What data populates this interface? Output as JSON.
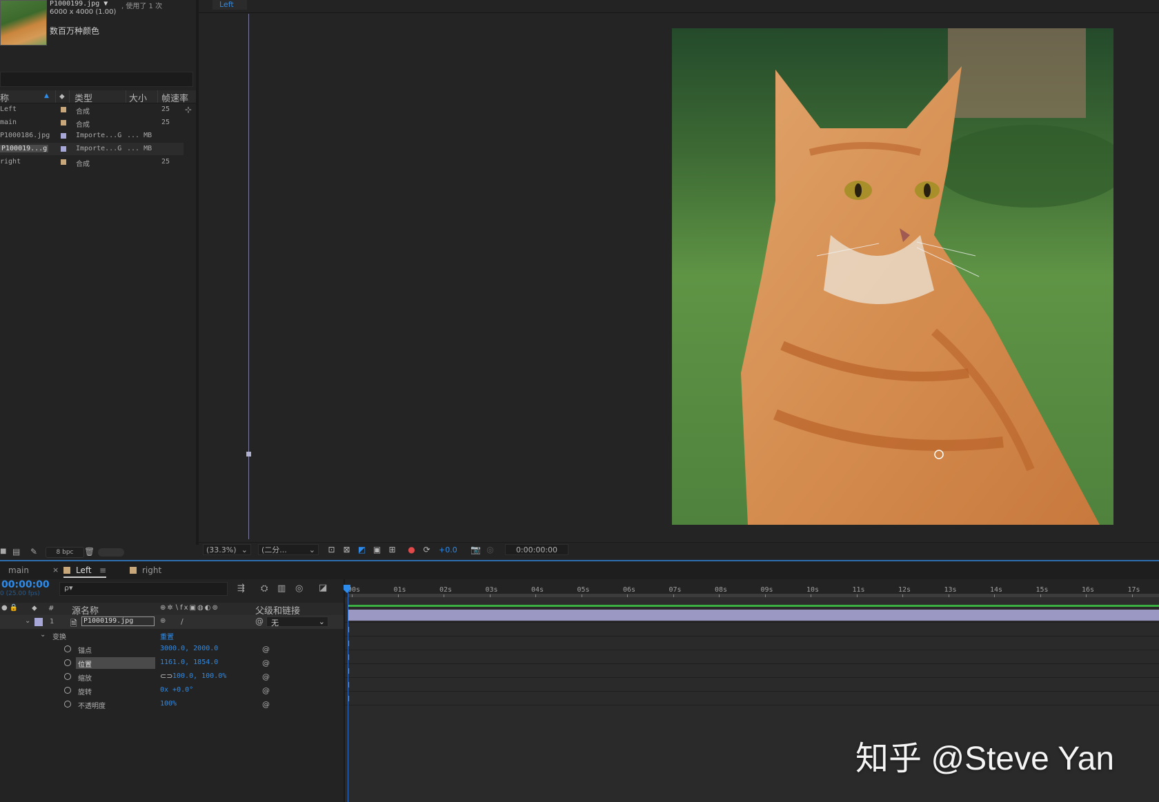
{
  "project": {
    "thumb_name": "P1000199.jpg ▼",
    "thumb_used": ", 使用了 1 次",
    "thumb_dims": "6000 x 4000 (1.00)",
    "thumb_color": "数百万种颜色",
    "columns": {
      "name": "称",
      "type": "类型",
      "size": "大小",
      "fps": "帧速率"
    },
    "items": [
      {
        "name": "Left",
        "type": "合成",
        "size": "",
        "fps": "25",
        "color": "#c8a77a"
      },
      {
        "name": "main",
        "type": "合成",
        "size": "",
        "fps": "25",
        "color": "#c8a77a"
      },
      {
        "name": "P1000186.jpg",
        "type": "Importe...G",
        "size": "... MB",
        "fps": "",
        "color": "#a7a7d8"
      },
      {
        "name": "P100019...g",
        "type": "Importe...G",
        "size": "... MB",
        "fps": "",
        "color": "#a7a7d8"
      },
      {
        "name": "right",
        "type": "合成",
        "size": "",
        "fps": "25",
        "color": "#c8a77a"
      }
    ],
    "bpc": "8 bpc"
  },
  "viewer": {
    "tab": "Left",
    "zoom": "(33.3%)",
    "resolution": "(二分...",
    "exposure": "+0.0",
    "timecode": "0:00:00:00"
  },
  "timeline": {
    "tabs": [
      {
        "label": "main"
      },
      {
        "label": "Left"
      },
      {
        "label": "right"
      }
    ],
    "current_time": "00:00:00",
    "fps_hint": "0 (25.00 fps)",
    "search_placeholder": "ρ▾",
    "ruler_labels": [
      "00s",
      "01s",
      "02s",
      "03s",
      "04s",
      "05s",
      "06s",
      "07s",
      "08s",
      "09s",
      "10s",
      "11s",
      "12s",
      "13s",
      "14s",
      "15s",
      "16s",
      "17s"
    ],
    "col_source": "源名称",
    "col_parent": "父级和链接",
    "layer": {
      "index": "1",
      "name": "P1000199.jpg",
      "parent": "无"
    },
    "transform": {
      "label": "变换",
      "reset": "重置"
    },
    "properties": [
      {
        "label": "锚点",
        "value": "3000.0, 2000.0"
      },
      {
        "label": "位置",
        "value": "1161.0, 1854.0"
      },
      {
        "label": "缩放",
        "value": "100.0, 100.0%"
      },
      {
        "label": "旋转",
        "value": "0x +0.0°"
      },
      {
        "label": "不透明度",
        "value": "100%"
      }
    ]
  },
  "watermark": "知乎 @Steve Yan",
  "colors": {
    "accent": "#2d8ceb",
    "layer_bar": "#9c98c4",
    "comp_swatch": "#c8a77a",
    "footage_swatch": "#a7a7d8"
  }
}
